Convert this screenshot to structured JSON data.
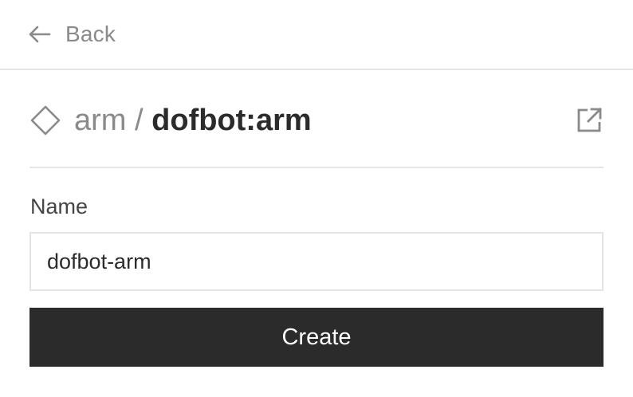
{
  "header": {
    "back_label": "Back",
    "back_icon": "arrow-left-icon"
  },
  "title": {
    "icon": "diamond-icon",
    "type": "arm",
    "separator": "/",
    "name": "dofbot:arm",
    "external_icon": "external-link-icon"
  },
  "form": {
    "name_label": "Name",
    "name_value": "dofbot-arm",
    "create_label": "Create"
  },
  "colors": {
    "muted_text": "#8a8a8a",
    "primary_text": "#2b2b2b",
    "button_bg": "#2b2b2b",
    "button_text": "#ffffff",
    "divider": "#e5e5e5"
  }
}
